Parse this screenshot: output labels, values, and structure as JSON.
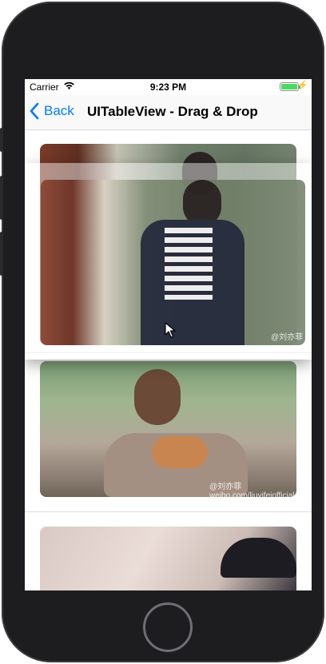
{
  "status_bar": {
    "carrier": "Carrier",
    "time": "9:23 PM"
  },
  "nav": {
    "back_label": "Back",
    "title": "UITableView - Drag & Drop"
  },
  "cells": [
    {
      "watermark": ""
    },
    {
      "watermark": "@刘亦菲 weibo.com/liuyifeiofficial"
    },
    {
      "watermark": ""
    }
  ],
  "dragging": {
    "watermark": "@刘亦菲"
  },
  "icons": [
    "wifi-icon",
    "battery-icon",
    "charging-bolt-icon",
    "chevron-left-icon",
    "pointer-cursor-icon"
  ],
  "colors": {
    "accent": "#007aff",
    "battery": "#4cd964",
    "device": "#1d1d1f"
  }
}
